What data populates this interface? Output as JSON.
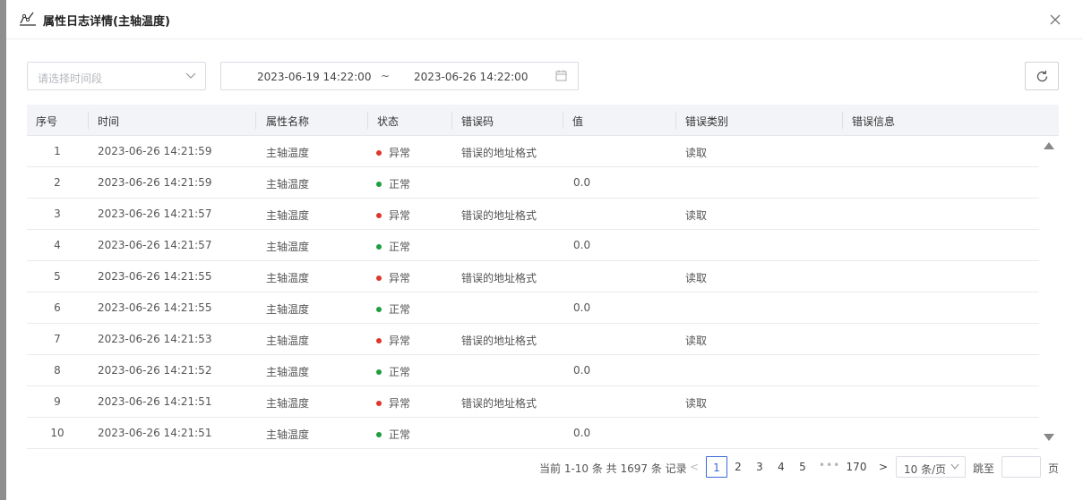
{
  "dialog": {
    "title": "属性日志详情(主轴温度)"
  },
  "filters": {
    "period_placeholder": "请选择时间段",
    "start": "2023-06-19 14:22:00",
    "separator": "~",
    "end": "2023-06-26 14:22:00"
  },
  "table": {
    "columns": [
      "序号",
      "时间",
      "属性名称",
      "状态",
      "错误码",
      "值",
      "错误类别",
      "错误信息"
    ],
    "rows": [
      {
        "idx": "1",
        "time": "2023-06-26 14:21:59",
        "name": "主轴温度",
        "status": "异常",
        "code": "错误的地址格式",
        "value": "",
        "type": "读取",
        "msg": ""
      },
      {
        "idx": "2",
        "time": "2023-06-26 14:21:59",
        "name": "主轴温度",
        "status": "正常",
        "code": "",
        "value": "0.0",
        "type": "",
        "msg": ""
      },
      {
        "idx": "3",
        "time": "2023-06-26 14:21:57",
        "name": "主轴温度",
        "status": "异常",
        "code": "错误的地址格式",
        "value": "",
        "type": "读取",
        "msg": ""
      },
      {
        "idx": "4",
        "time": "2023-06-26 14:21:57",
        "name": "主轴温度",
        "status": "正常",
        "code": "",
        "value": "0.0",
        "type": "",
        "msg": ""
      },
      {
        "idx": "5",
        "time": "2023-06-26 14:21:55",
        "name": "主轴温度",
        "status": "异常",
        "code": "错误的地址格式",
        "value": "",
        "type": "读取",
        "msg": ""
      },
      {
        "idx": "6",
        "time": "2023-06-26 14:21:55",
        "name": "主轴温度",
        "status": "正常",
        "code": "",
        "value": "0.0",
        "type": "",
        "msg": ""
      },
      {
        "idx": "7",
        "time": "2023-06-26 14:21:53",
        "name": "主轴温度",
        "status": "异常",
        "code": "错误的地址格式",
        "value": "",
        "type": "读取",
        "msg": ""
      },
      {
        "idx": "8",
        "time": "2023-06-26 14:21:52",
        "name": "主轴温度",
        "status": "正常",
        "code": "",
        "value": "0.0",
        "type": "",
        "msg": ""
      },
      {
        "idx": "9",
        "time": "2023-06-26 14:21:51",
        "name": "主轴温度",
        "status": "异常",
        "code": "错误的地址格式",
        "value": "",
        "type": "读取",
        "msg": ""
      },
      {
        "idx": "10",
        "time": "2023-06-26 14:21:51",
        "name": "主轴温度",
        "status": "正常",
        "code": "",
        "value": "0.0",
        "type": "",
        "msg": ""
      }
    ]
  },
  "status_colors": {
    "异常": "#e0352b",
    "正常": "#1f9d3f"
  },
  "pagination": {
    "total_text": "当前 1-10 条 共 1697 条 记录",
    "prev": "<",
    "pages": [
      "1",
      "2",
      "3",
      "4",
      "5"
    ],
    "active": "1",
    "ellipsis": "•••",
    "last": "170",
    "next": ">",
    "page_size": "10 条/页",
    "jump_label": "跳至",
    "jump_suffix": "页"
  },
  "accent_color": "#3c6ad8"
}
